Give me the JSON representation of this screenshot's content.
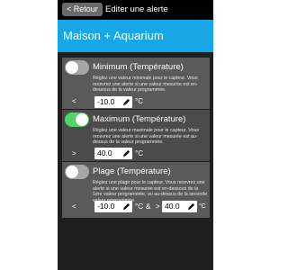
{
  "nav": {
    "back_label": "< Retour",
    "title": "Editer une alerte"
  },
  "header": {
    "title": "Maison + Aquarium"
  },
  "alerts": [
    {
      "title": "Minimum (Température)",
      "description": "Réglez une valeur minimale pour le capteur. Vous recevrez une alerte si une valeur mesurée est en-dessous de la valeur programmée.",
      "enabled": false,
      "operator": "<",
      "value": "-10.0",
      "unit": "°C"
    },
    {
      "title": "Maximum (Température)",
      "description": "Réglez une valeur maximale pour le capteur. Vous recevrez une alerte si une valeur mesurée est au-dessus de la valeur programmée.",
      "enabled": true,
      "operator": ">",
      "value": "40.0",
      "unit": "°C"
    },
    {
      "title": "Plage (Température)",
      "description": "Réglez une plage pour le capteur. Vous recevrez une alerte si une valeur mesurée est en-dessous de la 1ère valeur programmée, ou au-dessus de la seconde valeur programmée.",
      "enabled": false,
      "operator": "<",
      "value_low": "-10.0",
      "separator": "&",
      "operator_high": ">",
      "value_high": "40.0",
      "unit": "°C"
    }
  ],
  "colors": {
    "header": "#17a7e6",
    "toggle_on": "#4cd864",
    "toggle_off": "#a6a6a6"
  },
  "icons": {
    "edit": "pencil-icon"
  }
}
